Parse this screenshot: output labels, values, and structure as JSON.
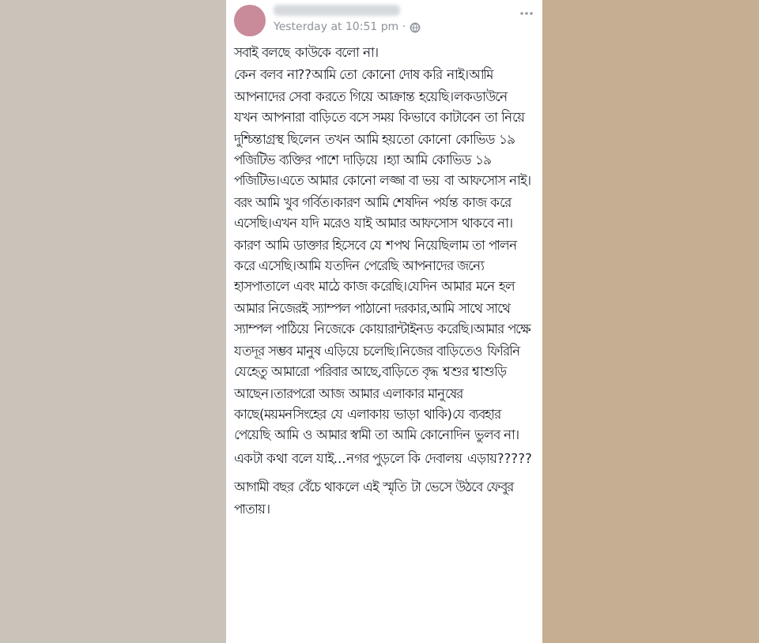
{
  "post": {
    "timestamp": "Yesterday at 10:51 pm · ",
    "paragraphs": [
      "সবাই বলছে কাউকে বলো না।",
      "কেন বলব না??আমি তো কোনো দোষ করি নাই।আমি আপনাদের সেবা করতে গিয়ে আক্রান্ত হয়েছি।লকডাউনে যখন আপনারা বাড়িতে বসে সময় কিভাবে কাটাবেন তা নিয়ে দুশ্চিন্তাগ্রস্থ ছিলেন তখন আমি হয়তো কোনো কোভিড ১৯ পজিটিভ ব্যক্তির পাশে দাড়িয়ে ।হ্যা আমি কোভিড ১৯ পজিটিভ।এতে আমার কোনো লজ্জা বা ভয় বা আফসোস নাই।বরং আমি খুব গর্বিত।কারণ আমি শেষদিন পর্যন্ত কাজ করে এসেছি।এখন যদি মরেও যাই আমার আফসোস থাকবে না।কারণ আমি ডাক্তার হিসেবে যে শপথ নিয়েছিলাম তা পালন করে এসেছি।আমি যতদিন পেরেছি আপনাদের জন্যে হাসপাতালে এবং মাঠে কাজ করেছি।যেদিন আমার মনে হল আমার নিজেরই স্যাম্পল পাঠানো দরকার,আমি সাথে সাথে স্যাম্পল পাঠিয়ে নিজেকে কোয়ারান্টাইনড করেছি।আমার পক্ষে যতদূর সম্ভব মানুষ এড়িয়ে চলেছি।নিজের বাড়িতেও ফিরিনি যেহেতু আমারো পরিবার আছে,বাড়িতে বৃদ্ধ শ্বশুর শ্বাশুড়ি আছেন।তারপরো আজ আমার এলাকার মানুষের কাছে(ময়মনসিংহের যে এলাকায় ভাড়া থাকি)যে ব্যবহার পেয়েছি আমি ও আমার স্বামী তা আমি কোনোদিন ভুলব না।",
      "একটা কথা বলে যাই...নগর পুড়লে কি দেবালয় এড়ায়?????",
      "আগামী বছর বেঁচে থাকলে এই স্মৃতি টা ভেসে উঠবে ফেবুর পাতায়।"
    ]
  }
}
